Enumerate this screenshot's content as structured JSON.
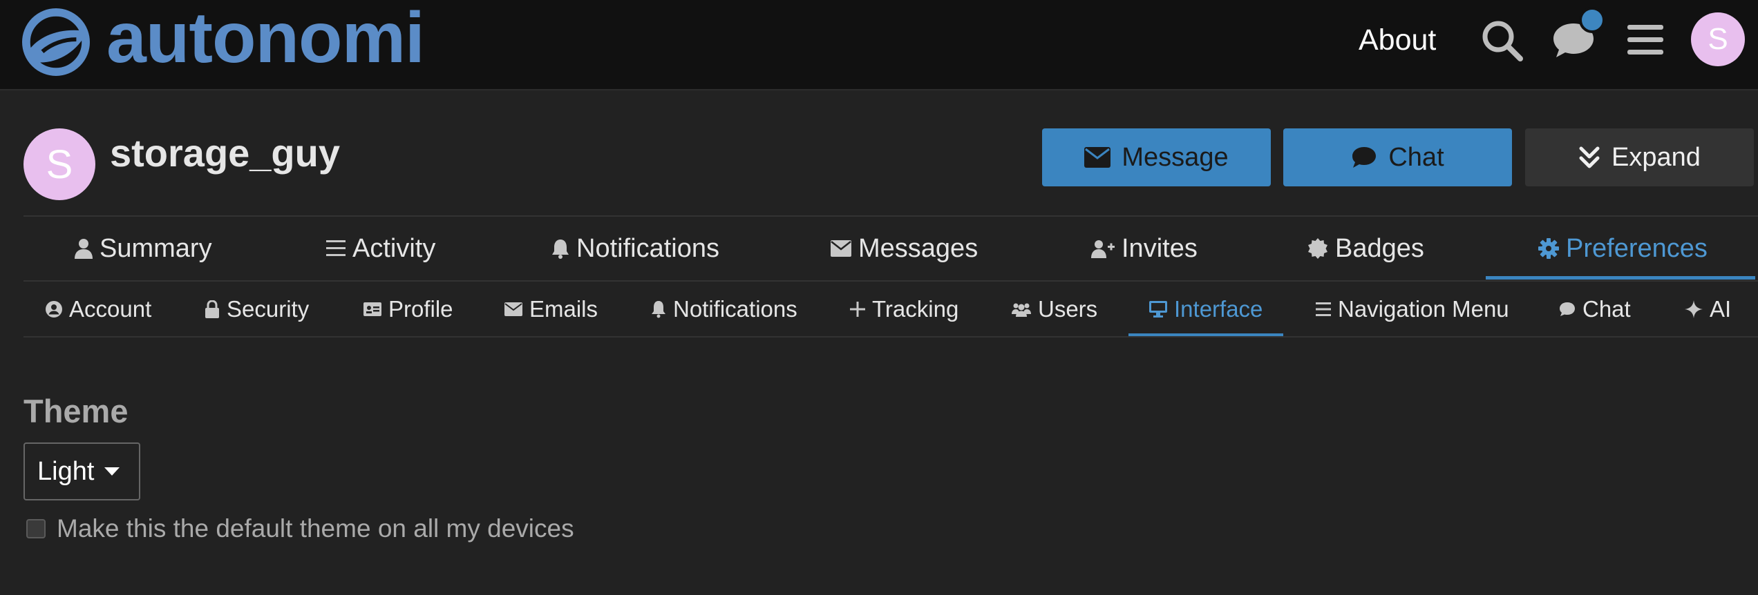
{
  "header": {
    "brand": "autonomi",
    "about_label": "About",
    "avatar_letter": "S"
  },
  "user": {
    "avatar_letter": "S",
    "username": "storage_guy"
  },
  "actions": {
    "message": "Message",
    "chat": "Chat",
    "expand": "Expand"
  },
  "primary_tabs": [
    {
      "label": "Summary",
      "icon": "user-icon"
    },
    {
      "label": "Activity",
      "icon": "list-icon"
    },
    {
      "label": "Notifications",
      "icon": "bell-icon"
    },
    {
      "label": "Messages",
      "icon": "envelope-icon"
    },
    {
      "label": "Invites",
      "icon": "user-plus-icon"
    },
    {
      "label": "Badges",
      "icon": "certificate-icon"
    },
    {
      "label": "Preferences",
      "icon": "gear-icon",
      "active": true
    }
  ],
  "secondary_tabs": [
    {
      "label": "Account",
      "icon": "user-circle-icon"
    },
    {
      "label": "Security",
      "icon": "lock-icon"
    },
    {
      "label": "Profile",
      "icon": "id-card-icon"
    },
    {
      "label": "Emails",
      "icon": "envelope-icon"
    },
    {
      "label": "Notifications",
      "icon": "bell-icon"
    },
    {
      "label": "Tracking",
      "icon": "plus-icon"
    },
    {
      "label": "Users",
      "icon": "users-icon"
    },
    {
      "label": "Interface",
      "icon": "desktop-icon",
      "active": true
    },
    {
      "label": "Navigation Menu",
      "icon": "bars-icon"
    },
    {
      "label": "Chat",
      "icon": "comment-icon"
    },
    {
      "label": "AI",
      "icon": "sparkle-icon"
    }
  ],
  "theme": {
    "heading": "Theme",
    "selected": "Light",
    "default_label": "Make this the default theme on all my devices",
    "default_checked": false
  },
  "colors": {
    "accent": "#3b85c0",
    "active_text": "#4e98d3",
    "brand": "#5b8cc7",
    "avatar": "#e8bfee",
    "background": "#222222",
    "header_bg": "#111111"
  }
}
